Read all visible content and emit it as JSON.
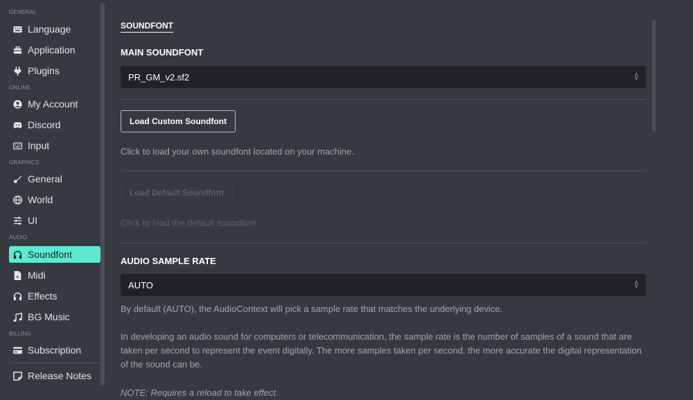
{
  "sidebar": {
    "categories": {
      "general": "GENERAL",
      "online": "ONLINE",
      "graphics": "GRAPHICS",
      "audio": "AUDIO",
      "billing": "BILLING"
    },
    "items": {
      "language": {
        "label": "Language",
        "icon": "keyboard-icon"
      },
      "application": {
        "label": "Application",
        "icon": "toolbox-icon"
      },
      "plugins": {
        "label": "Plugins",
        "icon": "plug-icon"
      },
      "my_account": {
        "label": "My Account",
        "icon": "user-circle-icon"
      },
      "discord": {
        "label": "Discord",
        "icon": "discord-icon"
      },
      "input": {
        "label": "Input",
        "icon": "keyboard-icon"
      },
      "general": {
        "label": "General",
        "icon": "paint-icon"
      },
      "world": {
        "label": "World",
        "icon": "globe-icon"
      },
      "ui": {
        "label": "UI",
        "icon": "sliders-icon"
      },
      "soundfont": {
        "label": "Soundfont",
        "icon": "headphones-icon"
      },
      "midi": {
        "label": "Midi",
        "icon": "file-audio-icon"
      },
      "effects": {
        "label": "Effects",
        "icon": "headphones-icon"
      },
      "bg_music": {
        "label": "BG Music",
        "icon": "music-icon"
      },
      "subscription": {
        "label": "Subscription",
        "icon": "card-icon"
      },
      "release_notes": {
        "label": "Release Notes",
        "icon": "note-icon"
      }
    },
    "active_color": "#5ee8d2"
  },
  "main": {
    "section_title": "SOUNDFONT",
    "main_soundfont": {
      "heading": "MAIN SOUNDFONT",
      "value": "PR_GM_v2.sf2"
    },
    "load_custom": {
      "label": "Load Custom Soundfont",
      "description": "Click to load your own soundfont located on your machine."
    },
    "load_default": {
      "label": "Load Default Soundfont",
      "description": "Click to load the default soundfont."
    },
    "sample_rate": {
      "heading": "AUDIO SAMPLE RATE",
      "value": "AUTO",
      "description1": "By default (AUTO), the AudioContext will pick a sample rate that matches the underlying device.",
      "description2": "In developing an audio sound for computers or telecommunication, the sample rate is the number of samples of a sound that are taken per second to represent the event digitally. The more samples taken per second, the more accurate the digital representation of the sound can be.",
      "note": "NOTE: Requires a reload to take effect."
    }
  }
}
